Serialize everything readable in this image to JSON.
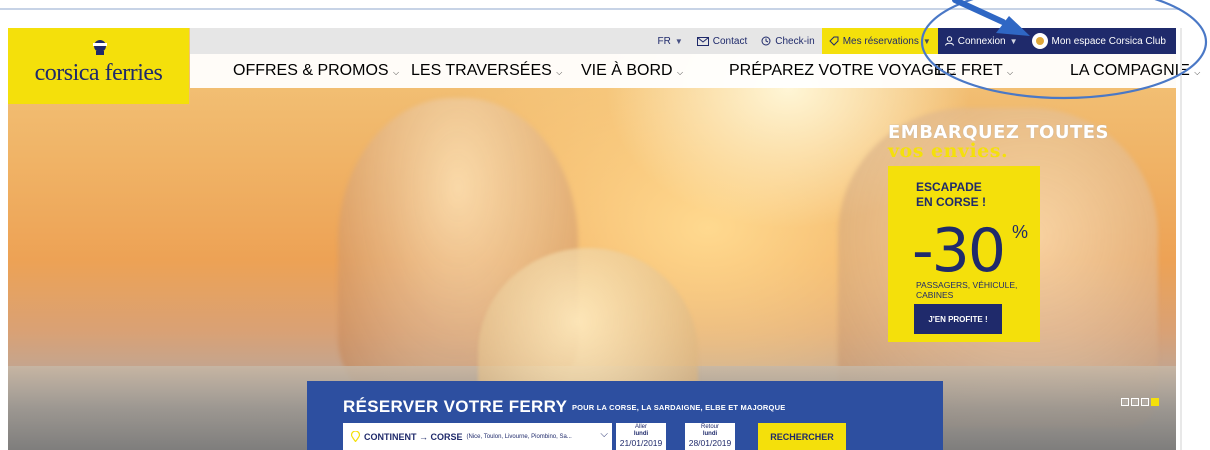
{
  "brand": {
    "logo_text": "corsica ferries",
    "colors": {
      "yellow": "#f4e00b",
      "navy": "#1f2a6b",
      "booking_blue": "#2d4fa0"
    }
  },
  "utility_bar": {
    "language": "FR",
    "contact": "Contact",
    "checkin": "Check-in",
    "reservations": "Mes réservations",
    "connexion": "Connexion",
    "club": "Mon espace Corsica Club",
    "icons": [
      "chevron-down-icon",
      "mail-icon",
      "clock-icon",
      "tag-icon",
      "user-icon",
      "club-badge-icon"
    ]
  },
  "main_nav": {
    "items": [
      {
        "label": "OFFRES & PROMOS"
      },
      {
        "label": "LES TRAVERSÉES"
      },
      {
        "label": "VIE À BORD"
      },
      {
        "label": "PRÉPAREZ VOTRE VOYAGE"
      },
      {
        "label": "LE FRET"
      },
      {
        "label": "LA COMPAGNIE"
      }
    ]
  },
  "promo": {
    "headline_1": "EMBARQUEZ TOUTES",
    "headline_2": "vos envies.",
    "escapade_1": "ESCAPADE",
    "escapade_2": "EN CORSE !",
    "discount": "-30",
    "percent": "%",
    "description": "PASSAGERS, VÉHICULE, CABINES",
    "cta": "J'EN PROFITE !"
  },
  "carousel": {
    "count": 4,
    "active_index": 3
  },
  "booking": {
    "title": "RÉSERVER VOTRE FERRY",
    "subtitle": "POUR LA CORSE, LA SARDAIGNE, ELBE ET MAJORQUE",
    "route_main": "CONTINENT → CORSE",
    "route_detail": "(Nice, Toulon, Livourne, Piombino, Sa...",
    "outbound": {
      "label": "Aller",
      "day": "lundi",
      "date": "21/01/2019"
    },
    "return": {
      "label": "Retour",
      "day": "lundi",
      "date": "28/01/2019"
    },
    "search": "RECHERCHER"
  }
}
